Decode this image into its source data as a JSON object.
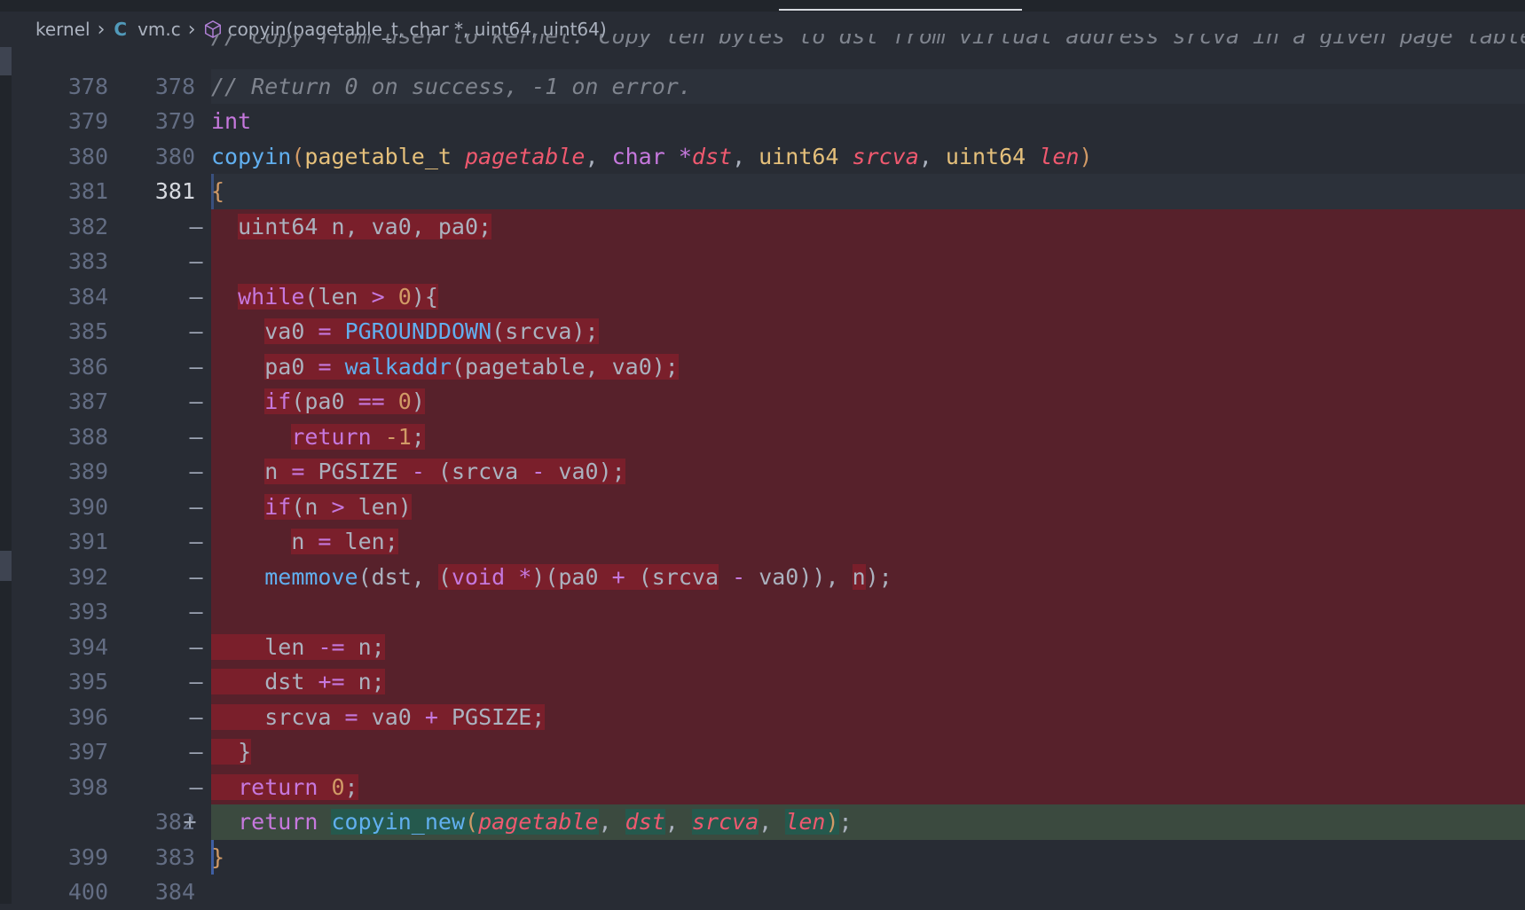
{
  "breadcrumb": {
    "folder": "kernel",
    "file_icon": "C",
    "file": "vm.c",
    "symbol": "copyin(pagetable_t, char *, uint64, uint64)"
  },
  "diff_lines": [
    {
      "old": "",
      "new": "",
      "type": "partial",
      "tokens": [
        {
          "t": "// copy from user to kernel. Copy len bytes to dst from virtual address srcva in a given page table.",
          "c": "cm"
        }
      ]
    },
    {
      "old": "378",
      "new": "378",
      "type": "context-hl",
      "tokens": [
        {
          "t": "// Return 0 on success, -1 on error.",
          "c": "cm"
        }
      ]
    },
    {
      "old": "379",
      "new": "379",
      "type": "context",
      "tokens": [
        {
          "t": "int",
          "c": "kw"
        }
      ]
    },
    {
      "old": "380",
      "new": "380",
      "type": "context",
      "tokens": [
        {
          "t": "copyin",
          "c": "fn"
        },
        {
          "t": "(",
          "c": "br"
        },
        {
          "t": "pagetable_t ",
          "c": "ty"
        },
        {
          "t": "pagetable",
          "c": "pm"
        },
        {
          "t": ", ",
          "c": "txt"
        },
        {
          "t": "char ",
          "c": "kw"
        },
        {
          "t": "*",
          "c": "op"
        },
        {
          "t": "dst",
          "c": "pm"
        },
        {
          "t": ", ",
          "c": "txt"
        },
        {
          "t": "uint64 ",
          "c": "ty"
        },
        {
          "t": "srcva",
          "c": "pm"
        },
        {
          "t": ", ",
          "c": "txt"
        },
        {
          "t": "uint64 ",
          "c": "ty"
        },
        {
          "t": "len",
          "c": "pm"
        },
        {
          "t": ")",
          "c": "br"
        }
      ]
    },
    {
      "old": "381",
      "new": "381",
      "type": "context-hl",
      "current": true,
      "tokens": [
        {
          "t": "{",
          "c": "br"
        }
      ]
    },
    {
      "old": "382",
      "new": "",
      "marker": "—",
      "type": "del",
      "tokens": [
        {
          "t": "  ",
          "c": "txt"
        },
        {
          "t": "uint64 n, va0, pa0;",
          "c": "txt",
          "hl": true
        }
      ]
    },
    {
      "old": "383",
      "new": "",
      "marker": "—",
      "type": "del",
      "tokens": []
    },
    {
      "old": "384",
      "new": "",
      "marker": "—",
      "type": "del",
      "tokens": [
        {
          "t": "  ",
          "c": "txt"
        },
        {
          "t": "while",
          "c": "kw",
          "hl": true
        },
        {
          "t": "(len ",
          "c": "txt",
          "hl": true
        },
        {
          "t": ">",
          "c": "op",
          "hl": true
        },
        {
          "t": " ",
          "c": "txt",
          "hl": true
        },
        {
          "t": "0",
          "c": "num",
          "hl": true
        },
        {
          "t": "){",
          "c": "txt",
          "hl": true
        }
      ]
    },
    {
      "old": "385",
      "new": "",
      "marker": "—",
      "type": "del",
      "tokens": [
        {
          "t": "    ",
          "c": "txt"
        },
        {
          "t": "va0 ",
          "c": "txt",
          "hl": true
        },
        {
          "t": "=",
          "c": "op",
          "hl": true
        },
        {
          "t": " ",
          "c": "txt",
          "hl": true
        },
        {
          "t": "PGROUNDDOWN",
          "c": "fn",
          "hl": true
        },
        {
          "t": "(srcva);",
          "c": "txt",
          "hl": true
        }
      ]
    },
    {
      "old": "386",
      "new": "",
      "marker": "—",
      "type": "del",
      "tokens": [
        {
          "t": "    ",
          "c": "txt"
        },
        {
          "t": "pa0 ",
          "c": "txt",
          "hl": true
        },
        {
          "t": "=",
          "c": "op",
          "hl": true
        },
        {
          "t": " ",
          "c": "txt",
          "hl": true
        },
        {
          "t": "walkaddr",
          "c": "fn",
          "hl": true
        },
        {
          "t": "(pagetable, va0);",
          "c": "txt",
          "hl": true
        }
      ]
    },
    {
      "old": "387",
      "new": "",
      "marker": "—",
      "type": "del",
      "tokens": [
        {
          "t": "    ",
          "c": "txt"
        },
        {
          "t": "if",
          "c": "kw",
          "hl": true
        },
        {
          "t": "(pa0 ",
          "c": "txt",
          "hl": true
        },
        {
          "t": "==",
          "c": "op",
          "hl": true
        },
        {
          "t": " ",
          "c": "txt",
          "hl": true
        },
        {
          "t": "0",
          "c": "num",
          "hl": true
        },
        {
          "t": ")",
          "c": "txt",
          "hl": true
        }
      ]
    },
    {
      "old": "388",
      "new": "",
      "marker": "—",
      "type": "del",
      "tokens": [
        {
          "t": "      ",
          "c": "txt"
        },
        {
          "t": "return",
          "c": "kw",
          "hl": true
        },
        {
          "t": " ",
          "c": "txt",
          "hl": true
        },
        {
          "t": "-1",
          "c": "num",
          "hl": true
        },
        {
          "t": ";",
          "c": "txt",
          "hl": true
        }
      ]
    },
    {
      "old": "389",
      "new": "",
      "marker": "—",
      "type": "del",
      "tokens": [
        {
          "t": "    ",
          "c": "txt"
        },
        {
          "t": "n ",
          "c": "txt",
          "hl": true
        },
        {
          "t": "=",
          "c": "op",
          "hl": true
        },
        {
          "t": " PGSIZE ",
          "c": "txt",
          "hl": true
        },
        {
          "t": "-",
          "c": "op",
          "hl": true
        },
        {
          "t": " (srcva ",
          "c": "txt",
          "hl": true
        },
        {
          "t": "-",
          "c": "op",
          "hl": true
        },
        {
          "t": " va0);",
          "c": "txt",
          "hl": true
        }
      ]
    },
    {
      "old": "390",
      "new": "",
      "marker": "—",
      "type": "del",
      "tokens": [
        {
          "t": "    ",
          "c": "txt"
        },
        {
          "t": "if",
          "c": "kw",
          "hl": true
        },
        {
          "t": "(n ",
          "c": "txt",
          "hl": true
        },
        {
          "t": ">",
          "c": "op",
          "hl": true
        },
        {
          "t": " len)",
          "c": "txt",
          "hl": true
        }
      ]
    },
    {
      "old": "391",
      "new": "",
      "marker": "—",
      "type": "del",
      "tokens": [
        {
          "t": "      ",
          "c": "txt"
        },
        {
          "t": "n ",
          "c": "txt",
          "hl": true
        },
        {
          "t": "=",
          "c": "op",
          "hl": true
        },
        {
          "t": " len;",
          "c": "txt",
          "hl": true
        }
      ]
    },
    {
      "old": "392",
      "new": "",
      "marker": "—",
      "type": "del",
      "tokens": [
        {
          "t": "    ",
          "c": "txt"
        },
        {
          "t": "memmove",
          "c": "fn"
        },
        {
          "t": "(dst, ",
          "c": "txt"
        },
        {
          "t": "(",
          "c": "txt",
          "hl": true
        },
        {
          "t": "void ",
          "c": "kw",
          "hl": true
        },
        {
          "t": "*",
          "c": "op",
          "hl": true
        },
        {
          "t": ")(pa0 ",
          "c": "txt",
          "hl": true
        },
        {
          "t": "+",
          "c": "op",
          "hl": true
        },
        {
          "t": " (srcva",
          "c": "txt",
          "hl": true
        },
        {
          "t": " ",
          "c": "txt"
        },
        {
          "t": "-",
          "c": "op"
        },
        {
          "t": " va0)), ",
          "c": "txt"
        },
        {
          "t": "n",
          "c": "txt",
          "hl": true
        },
        {
          "t": ");",
          "c": "txt"
        }
      ]
    },
    {
      "old": "393",
      "new": "",
      "marker": "—",
      "type": "del",
      "tokens": []
    },
    {
      "old": "394",
      "new": "",
      "marker": "—",
      "type": "del",
      "tokens": [
        {
          "t": "    ",
          "c": "txt",
          "hl": true
        },
        {
          "t": "len ",
          "c": "txt",
          "hl": true
        },
        {
          "t": "-=",
          "c": "op",
          "hl": true
        },
        {
          "t": " n;",
          "c": "txt",
          "hl": true
        }
      ]
    },
    {
      "old": "395",
      "new": "",
      "marker": "—",
      "type": "del",
      "tokens": [
        {
          "t": "    ",
          "c": "txt",
          "hl": true
        },
        {
          "t": "dst ",
          "c": "txt",
          "hl": true
        },
        {
          "t": "+=",
          "c": "op",
          "hl": true
        },
        {
          "t": " n;",
          "c": "txt",
          "hl": true
        }
      ]
    },
    {
      "old": "396",
      "new": "",
      "marker": "—",
      "type": "del",
      "tokens": [
        {
          "t": "    ",
          "c": "txt",
          "hl": true
        },
        {
          "t": "srcva ",
          "c": "txt",
          "hl": true
        },
        {
          "t": "=",
          "c": "op",
          "hl": true
        },
        {
          "t": " va0 ",
          "c": "txt",
          "hl": true
        },
        {
          "t": "+",
          "c": "op",
          "hl": true
        },
        {
          "t": " PGSIZE;",
          "c": "txt",
          "hl": true
        }
      ]
    },
    {
      "old": "397",
      "new": "",
      "marker": "—",
      "type": "del",
      "tokens": [
        {
          "t": "  ",
          "c": "txt",
          "hl": true
        },
        {
          "t": "}",
          "c": "txt",
          "hl": true
        }
      ]
    },
    {
      "old": "398",
      "new": "",
      "marker": "—",
      "type": "del",
      "tokens": [
        {
          "t": "  ",
          "c": "txt",
          "hl": true
        },
        {
          "t": "return",
          "c": "kw",
          "hl": true
        },
        {
          "t": " ",
          "c": "txt",
          "hl": true
        },
        {
          "t": "0",
          "c": "num",
          "hl": true
        },
        {
          "t": ";",
          "c": "txt",
          "hl": true
        }
      ]
    },
    {
      "old": "",
      "new": "382",
      "marker": "+",
      "type": "ins",
      "tokens": [
        {
          "t": "  ",
          "c": "txt"
        },
        {
          "t": "return",
          "c": "kw"
        },
        {
          "t": " ",
          "c": "txt"
        },
        {
          "t": "copyin_new",
          "c": "fn",
          "hl": true
        },
        {
          "t": "(",
          "c": "br",
          "hl": true
        },
        {
          "t": "pagetable",
          "c": "pm",
          "hl": true
        },
        {
          "t": ", ",
          "c": "txt"
        },
        {
          "t": "dst",
          "c": "pm",
          "hl": true
        },
        {
          "t": ", ",
          "c": "txt"
        },
        {
          "t": "srcva",
          "c": "pm",
          "hl": true
        },
        {
          "t": ", ",
          "c": "txt"
        },
        {
          "t": "len",
          "c": "pm",
          "hl": true
        },
        {
          "t": ")",
          "c": "br",
          "hl": true
        },
        {
          "t": ";",
          "c": "txt"
        }
      ]
    },
    {
      "old": "399",
      "new": "383",
      "type": "context",
      "cursor": true,
      "tokens": [
        {
          "t": "}",
          "c": "br"
        }
      ]
    },
    {
      "old": "400",
      "new": "384",
      "type": "context",
      "tokens": []
    }
  ],
  "colors": {
    "editor_bg": "#282c34",
    "deleted_line_bg": "#57212b",
    "deleted_text_bg": "#7a1f2b",
    "inserted_line_bg": "#3b4a3f",
    "inserted_text_bg": "#25594d",
    "keyword": "#c678dd",
    "function": "#61afef",
    "type": "#e5c07b",
    "parameter": "#ef596f",
    "number": "#d19a66",
    "comment": "#7f848e"
  }
}
